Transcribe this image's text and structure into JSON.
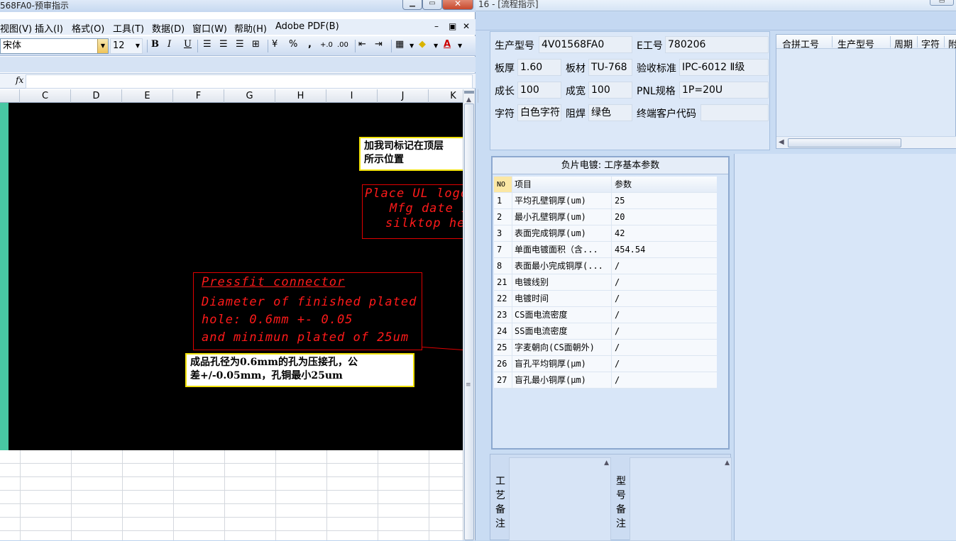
{
  "right_window": {
    "title": "16 - [流程指示]",
    "info": {
      "model_label": "生产型号",
      "model_value": "4V01568FA0",
      "eno_label": "E工号",
      "eno_value": "780206",
      "thickness_label": "板厚",
      "thickness_value": "1.60",
      "material_label": "板材",
      "material_value": "TU-768",
      "standard_label": "验收标准",
      "standard_value": "IPC-6012 Ⅱ级",
      "length_label": "成长",
      "length_value": "100",
      "width_label": "成宽",
      "width_value": "100",
      "pnl_label": "PNL规格",
      "pnl_value": "1P=20U",
      "legend_label": "字符",
      "legend_value": "白色字符",
      "mask_label": "阻焊",
      "mask_value": "绿色",
      "customer_label": "终端客户代码",
      "customer_value": ""
    },
    "combine_grid": {
      "headers": [
        "合拼工号",
        "生产型号",
        "周期",
        "字符",
        "附"
      ]
    },
    "plating": {
      "title": "负片电镀: 工序基本参数",
      "headers": [
        "NO",
        "项目",
        "参数"
      ],
      "rows": [
        {
          "no": "1",
          "item": "平均孔壁铜厚(um)",
          "value": "25"
        },
        {
          "no": "2",
          "item": "最小孔壁铜厚(um)",
          "value": "20"
        },
        {
          "no": "3",
          "item": "表面完成铜厚(um)",
          "value": "42"
        },
        {
          "no": "7",
          "item": "单面电镀面积（含...",
          "value": "454.54"
        },
        {
          "no": "8",
          "item": "表面最小完成铜厚(...",
          "value": "/"
        },
        {
          "no": "21",
          "item": "电镀线别",
          "value": "/"
        },
        {
          "no": "22",
          "item": "电镀时间",
          "value": "/"
        },
        {
          "no": "23",
          "item": "CS面电流密度",
          "value": "/"
        },
        {
          "no": "24",
          "item": "SS面电流密度",
          "value": "/"
        },
        {
          "no": "25",
          "item": "字麦朝向(CS面朝外)",
          "value": "/"
        },
        {
          "no": "26",
          "item": "盲孔平均铜厚(μm)",
          "value": "/"
        },
        {
          "no": "27",
          "item": "盲孔最小铜厚(μm)",
          "value": "/"
        }
      ]
    },
    "notes": {
      "process_label": [
        "工",
        "艺",
        "备",
        "注"
      ],
      "model_label": [
        "型",
        "号",
        "备",
        "注"
      ]
    }
  },
  "excel": {
    "title": "568FA0-预审指示",
    "menu": [
      "视图(V)",
      "插入(I)",
      "格式(O)",
      "工具(T)",
      "数据(D)",
      "窗口(W)",
      "帮助(H)",
      "Adobe PDF(B)"
    ],
    "font_name": "宋体",
    "font_size": "12",
    "toolbar": {
      "bold": "B",
      "italic": "I",
      "underline": "U",
      "percent": "%",
      "comma": ","
    },
    "fx_label": "fx",
    "columns": [
      "C",
      "D",
      "E",
      "F",
      "G",
      "H",
      "I",
      "J",
      "K"
    ],
    "note1": "加我司标记在顶层所示位置",
    "note1_line1": "加我司标记在顶层",
    "note1_line2": "所示位置",
    "red_top_lines": [
      "Place UL logo",
      "Mfg date i",
      "silktop he"
    ],
    "red_mid_lines": [
      "Pressfit connector",
      "Diameter of finished plated",
      "hole: 0.6mm +- 0.05",
      "and minimun plated of 25um"
    ],
    "note2_line1": "成品孔径为0.6mm的孔为压接孔，公",
    "note2_line2": "差+/-0.05mm，孔铜最小25um"
  }
}
